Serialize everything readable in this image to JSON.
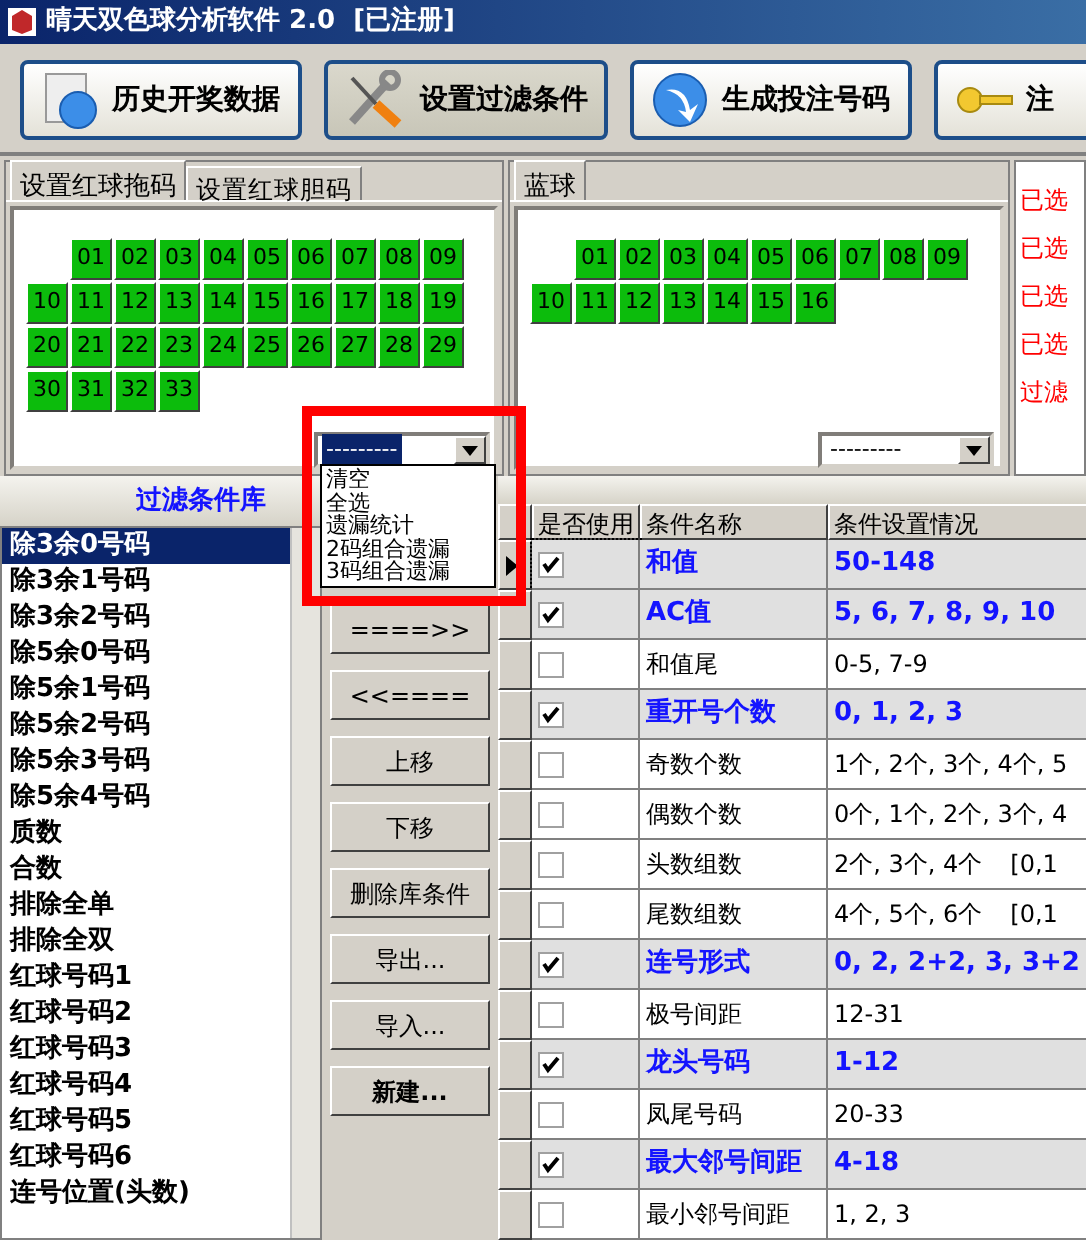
{
  "window": {
    "title": "晴天双色球分析软件 2.0  [已注册]"
  },
  "toolbar": [
    {
      "kind": "history",
      "label": "历史开奖数据",
      "selected": false
    },
    {
      "kind": "tools",
      "label": "设置过滤条件",
      "selected": true
    },
    {
      "kind": "generate",
      "label": "生成投注号码",
      "selected": false
    },
    {
      "kind": "key",
      "label": "注",
      "selected": false
    }
  ],
  "red_panel": {
    "tabs": [
      {
        "label": "设置红球拖码",
        "selected": true
      },
      {
        "label": "设置红球胆码",
        "selected": false
      }
    ],
    "balls": [
      "01",
      "02",
      "03",
      "04",
      "05",
      "06",
      "07",
      "08",
      "09",
      "10",
      "11",
      "12",
      "13",
      "14",
      "15",
      "16",
      "17",
      "18",
      "19",
      "20",
      "21",
      "22",
      "23",
      "24",
      "25",
      "26",
      "27",
      "28",
      "29",
      "30",
      "31",
      "32",
      "33"
    ],
    "dropdown": {
      "value": "---------",
      "expanded": true,
      "options": [
        "清空",
        "全选",
        "遗漏统计",
        "2码组合遗漏",
        "3码组合遗漏"
      ]
    }
  },
  "blue_panel": {
    "tabs": [
      {
        "label": "蓝球",
        "selected": true
      }
    ],
    "balls": [
      "01",
      "02",
      "03",
      "04",
      "05",
      "06",
      "07",
      "08",
      "09",
      "10",
      "11",
      "12",
      "13",
      "14",
      "15",
      "16"
    ],
    "dropdown": {
      "value": "---------",
      "expanded": false
    }
  },
  "status_lines": [
    "已选",
    "已选",
    "已选",
    "已选",
    "过滤"
  ],
  "library": {
    "title": "过滤条件库",
    "items": [
      {
        "label": "除3余0号码",
        "selected": true
      },
      {
        "label": "除3余1号码",
        "selected": false
      },
      {
        "label": "除3余2号码",
        "selected": false
      },
      {
        "label": "除5余0号码",
        "selected": false
      },
      {
        "label": "除5余1号码",
        "selected": false
      },
      {
        "label": "除5余2号码",
        "selected": false
      },
      {
        "label": "除5余3号码",
        "selected": false
      },
      {
        "label": "除5余4号码",
        "selected": false
      },
      {
        "label": "质数",
        "selected": false
      },
      {
        "label": "合数",
        "selected": false
      },
      {
        "label": "排除全单",
        "selected": false
      },
      {
        "label": "排除全双",
        "selected": false
      },
      {
        "label": "红球号码1",
        "selected": false
      },
      {
        "label": "红球号码2",
        "selected": false
      },
      {
        "label": "红球号码3",
        "selected": false
      },
      {
        "label": "红球号码4",
        "selected": false
      },
      {
        "label": "红球号码5",
        "selected": false
      },
      {
        "label": "红球号码6",
        "selected": false
      },
      {
        "label": "连号位置(头数)",
        "selected": false
      }
    ]
  },
  "actions": [
    "====>>",
    "<<====",
    "上移",
    "下移",
    "删除库条件",
    "导出...",
    "导入...",
    "新建..."
  ],
  "table": {
    "columns": [
      "是否使用",
      "条件名称",
      "条件设置情况"
    ],
    "rows": [
      {
        "current": true,
        "checked": true,
        "name": "和值",
        "setting": "50-148"
      },
      {
        "current": false,
        "checked": true,
        "name": "AC值",
        "setting": "5, 6, 7, 8, 9, 10"
      },
      {
        "current": false,
        "checked": false,
        "name": "和值尾",
        "setting": "0-5, 7-9"
      },
      {
        "current": false,
        "checked": true,
        "name": "重开号个数",
        "setting": "0, 1, 2, 3"
      },
      {
        "current": false,
        "checked": false,
        "name": "奇数个数",
        "setting": "1个, 2个, 3个, 4个, 5"
      },
      {
        "current": false,
        "checked": false,
        "name": "偶数个数",
        "setting": "0个, 1个, 2个, 3个, 4"
      },
      {
        "current": false,
        "checked": false,
        "name": "头数组数",
        "setting": "2个, 3个, 4个",
        "extra": "[0,1"
      },
      {
        "current": false,
        "checked": false,
        "name": "尾数组数",
        "setting": "4个, 5个, 6个",
        "extra": "[0,1"
      },
      {
        "current": false,
        "checked": true,
        "name": "连号形式",
        "setting": "0, 2, 2+2, 3, 3+2"
      },
      {
        "current": false,
        "checked": false,
        "name": "极号间距",
        "setting": "12-31"
      },
      {
        "current": false,
        "checked": true,
        "name": "龙头号码",
        "setting": "1-12"
      },
      {
        "current": false,
        "checked": false,
        "name": "凤尾号码",
        "setting": "20-33"
      },
      {
        "current": false,
        "checked": true,
        "name": "最大邻号间距",
        "setting": "4-18"
      },
      {
        "current": false,
        "checked": false,
        "name": "最小邻号间距",
        "setting": "1, 2, 3"
      }
    ]
  }
}
